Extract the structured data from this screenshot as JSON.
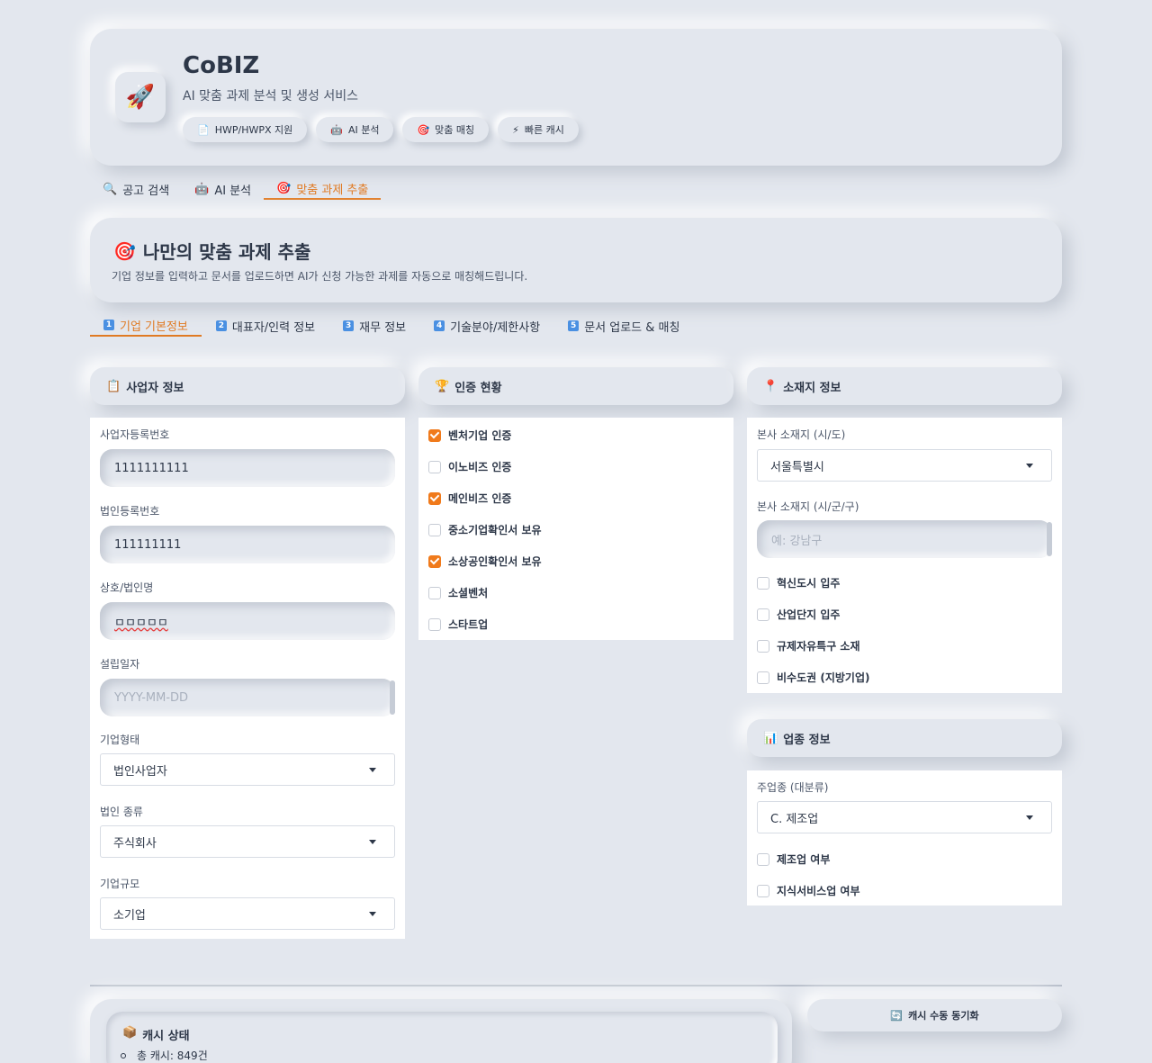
{
  "header": {
    "logo_icon": "🚀",
    "title": "CoBIZ",
    "subtitle": "AI 맞춤 과제 분석 및 생성 서비스",
    "pills": [
      {
        "icon": "📄",
        "label": "HWP/HWPX 지원"
      },
      {
        "icon": "🤖",
        "label": "AI 분석"
      },
      {
        "icon": "🎯",
        "label": "맞춤 매칭"
      },
      {
        "icon": "⚡",
        "label": "빠른 캐시"
      }
    ]
  },
  "main_tabs": [
    {
      "icon": "🔍",
      "label": "공고 검색"
    },
    {
      "icon": "🤖",
      "label": "AI 분석"
    },
    {
      "icon": "🎯",
      "label": "맞춤 과제 추출"
    }
  ],
  "section": {
    "icon": "🎯",
    "title": "나만의 맞춤 과제 추출",
    "description": "기업 정보를 입력하고 문서를 업로드하면 AI가 신청 가능한 과제를 자동으로 매칭해드립니다."
  },
  "sub_tabs": [
    {
      "num": "1",
      "label": "기업 기본정보"
    },
    {
      "num": "2",
      "label": "대표자/인력 정보"
    },
    {
      "num": "3",
      "label": "재무 정보"
    },
    {
      "num": "4",
      "label": "기술분야/제한사항"
    },
    {
      "num": "5",
      "label": "문서 업로드 & 매칭"
    }
  ],
  "business": {
    "icon": "📋",
    "title": "사업자 정보",
    "reg_no_label": "사업자등록번호",
    "reg_no_value": "1111111111",
    "corp_no_label": "법인등록번호",
    "corp_no_value": "111111111",
    "name_label": "상호/법인명",
    "name_value": "ㅁㅁㅁㅁㅁ",
    "founded_label": "설립일자",
    "founded_placeholder": "YYYY-MM-DD",
    "type_label": "기업형태",
    "type_value": "법인사업자",
    "corp_kind_label": "법인 종류",
    "corp_kind_value": "주식회사",
    "size_label": "기업규모",
    "size_value": "소기업"
  },
  "certs": {
    "icon": "🏆",
    "title": "인증 현황",
    "items": [
      {
        "label": "벤처기업 인증",
        "checked": true
      },
      {
        "label": "이노비즈 인증",
        "checked": false
      },
      {
        "label": "메인비즈 인증",
        "checked": true
      },
      {
        "label": "중소기업확인서 보유",
        "checked": false
      },
      {
        "label": "소상공인확인서 보유",
        "checked": true
      },
      {
        "label": "소셜벤처",
        "checked": false
      },
      {
        "label": "스타트업",
        "checked": false
      }
    ]
  },
  "location": {
    "icon": "📍",
    "title": "소재지 정보",
    "province_label": "본사 소재지 (시/도)",
    "province_value": "서울특별시",
    "city_label": "본사 소재지 (시/군/구)",
    "city_placeholder": "예: 강남구",
    "items": [
      {
        "label": "혁신도시 입주",
        "checked": false
      },
      {
        "label": "산업단지 입주",
        "checked": false
      },
      {
        "label": "규제자유특구 소재",
        "checked": false
      },
      {
        "label": "비수도권 (지방기업)",
        "checked": false
      }
    ]
  },
  "industry": {
    "icon": "📊",
    "title": "업종 정보",
    "main_label": "주업종 (대분류)",
    "main_value": "C. 제조업",
    "items": [
      {
        "label": "제조업 여부",
        "checked": false
      },
      {
        "label": "지식서비스업 여부",
        "checked": false
      }
    ]
  },
  "cache": {
    "icon": "📦",
    "title": "캐시 상태",
    "total": "총 캐시: 849건"
  },
  "sync_button": {
    "icon": "🔄",
    "label": "캐시 수동 동기화"
  }
}
